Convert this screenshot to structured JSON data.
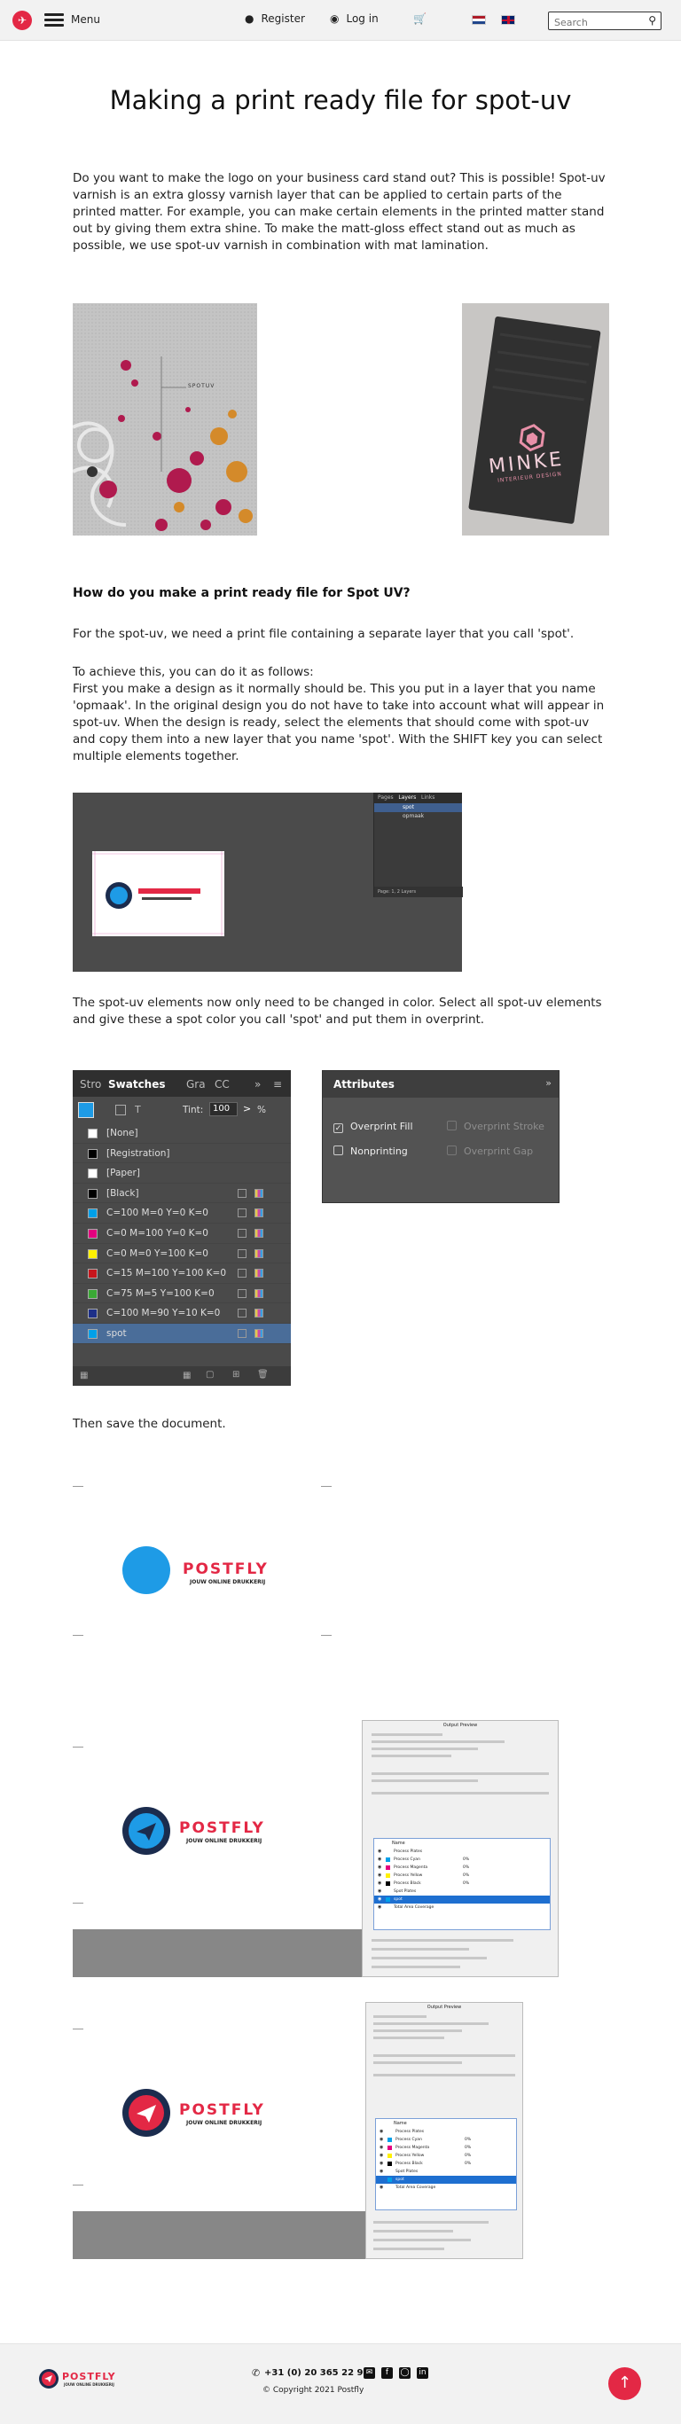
{
  "header": {
    "menu_label": "Menu",
    "register_label": "Register",
    "login_label": "Log in",
    "search_placeholder": "Search",
    "logo_glyph": "✈",
    "user_icon": "user-icon",
    "login_icon": "login-icon",
    "cart_icon": "cart-icon",
    "search_icon": "search-icon"
  },
  "article": {
    "title": "Making a print ready file for spot-uv",
    "intro": "Do you want to make the logo on your business card stand out? This is possible! Spot-uv varnish is an extra glossy varnish layer that can be applied to certain parts of the printed matter. For example, you can make certain elements in the printed matter stand out by giving them extra shine. To make the matt-gloss effect stand out as much as possible, we use spot-uv varnish in combination with mat lamination.",
    "subheading": "How do you make a print ready file for Spot UV?",
    "para1": "For the spot-uv, we need a print file containing a separate layer that you call 'spot'.",
    "para2_lead": "To achieve this, you can do it as follows:",
    "para2": "First you make a design as it normally should be. This you put in a layer that you name 'opmaak'. In the original design you do not have to take into account what will appear in spot-uv. When the design is ready, select the elements that should come with spot-uv and copy them into a new layer that you name 'spot'. With the SHIFT key you can select multiple elements together.",
    "para3": "The spot-uv elements now only need to be changed in color. Select all spot-uv elements and give these a spot color you call 'spot' and put them in overprint.",
    "para4": "Then save the document."
  },
  "photos": {
    "floral_caption": "SPOTUV",
    "card_brand": "MINKE",
    "card_tagline": "INTERIEUR DESIGN"
  },
  "indesign": {
    "layers_tab_pages": "Pages",
    "layers_tab_layers": "Layers",
    "layers_tab_links": "Links",
    "layer_spot": "spot",
    "layer_opmaak": "opmaak",
    "layers_footer": "Page: 1, 2 Layers"
  },
  "brand": {
    "name": "POSTFLY",
    "tagline": "JOUW ONLINE DRUKKERIJ",
    "red": "#e32845",
    "spot_blue": "#1e9be6",
    "navy": "#1b2c4e"
  },
  "swatches": {
    "tabs": [
      "Stro",
      "Swatches",
      "Gra",
      "CC"
    ],
    "tint_label": "Tint:",
    "tint_value": "100",
    "tint_unit": "%",
    "rows": [
      {
        "name": "[None]",
        "color": "#ffffff"
      },
      {
        "name": "[Registration]",
        "color": "#000000"
      },
      {
        "name": "[Paper]",
        "color": "#ffffff"
      },
      {
        "name": "[Black]",
        "color": "#000000"
      },
      {
        "name": "C=100 M=0 Y=0 K=0",
        "color": "#00a0e9"
      },
      {
        "name": "C=0 M=100 Y=0 K=0",
        "color": "#e4007f"
      },
      {
        "name": "C=0 M=0 Y=100 K=0",
        "color": "#fff100"
      },
      {
        "name": "C=15 M=100 Y=100 K=0",
        "color": "#c8161d"
      },
      {
        "name": "C=75 M=5 Y=100 K=0",
        "color": "#3aa935"
      },
      {
        "name": "C=100 M=90 Y=10 K=0",
        "color": "#1d2f88"
      },
      {
        "name": "spot",
        "color": "#00a0e9"
      }
    ]
  },
  "attributes": {
    "title": "Attributes",
    "overprint_fill": "Overprint Fill",
    "overprint_stroke": "Overprint Stroke",
    "nonprinting": "Nonprinting",
    "overprint_gap": "Overprint Gap"
  },
  "output_preview": {
    "title": "Output Preview",
    "separations_header": "Name",
    "rows": [
      "Process Plates",
      "Process Cyan",
      "Process Magenta",
      "Process Yellow",
      "Process Black",
      "Spot Plates",
      "spot",
      "Total Area Coverage"
    ],
    "percent": [
      "",
      "0%",
      "0%",
      "0%",
      "0%",
      "",
      "",
      ""
    ]
  },
  "footer": {
    "phone": "+31 (0) 20 365 22 93",
    "copyright": "© Copyright 2021 Postfly",
    "icons": [
      "phone-icon",
      "mail-icon",
      "facebook-icon",
      "instagram-icon",
      "linkedin-icon"
    ]
  }
}
